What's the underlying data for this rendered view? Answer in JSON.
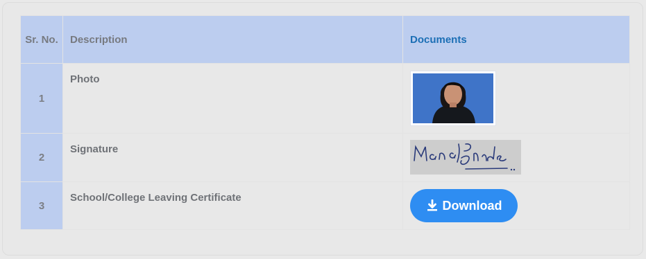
{
  "table": {
    "headers": {
      "sr": "Sr. No.",
      "description": "Description",
      "documents": "Documents"
    },
    "rows": [
      {
        "sr": "1",
        "description": "Photo",
        "document_type": "image",
        "document_alt": "applicant photograph"
      },
      {
        "sr": "2",
        "description": "Signature",
        "document_type": "image",
        "document_alt": "Manali Shinde"
      },
      {
        "sr": "3",
        "description": "School/College Leaving Certificate",
        "document_type": "button",
        "button_label": "Download",
        "button_icon": "download-icon"
      }
    ]
  },
  "colors": {
    "header_bg": "#bccdef",
    "documents_header_text": "#1c6fb5",
    "download_button": "#2e8df2"
  }
}
